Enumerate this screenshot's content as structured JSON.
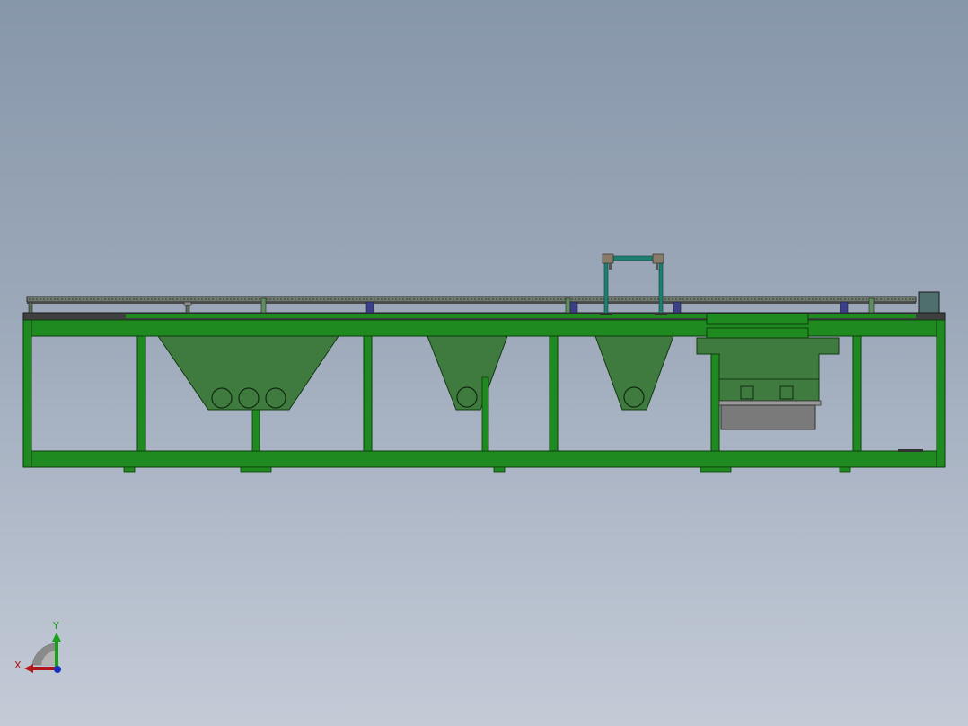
{
  "viewport": {
    "background_top": "#8797aa",
    "background_bottom": "#c4cbd7",
    "model_colors": {
      "frame": "#1f8a1f",
      "frame_edge": "#0c3d0c",
      "hopper": "#3f7a3f",
      "rail": "#6f7a6f",
      "gantry": "#1f7f6f",
      "gray_box": "#7a7a7a",
      "bracket_blue": "#3a3f8a"
    }
  },
  "triad": {
    "x_label": "X",
    "y_label": "Y",
    "x_color": "#b01818",
    "y_color": "#18a018",
    "z_color": "#1a2fc0",
    "icon": "view-orientation-triad-icon"
  }
}
